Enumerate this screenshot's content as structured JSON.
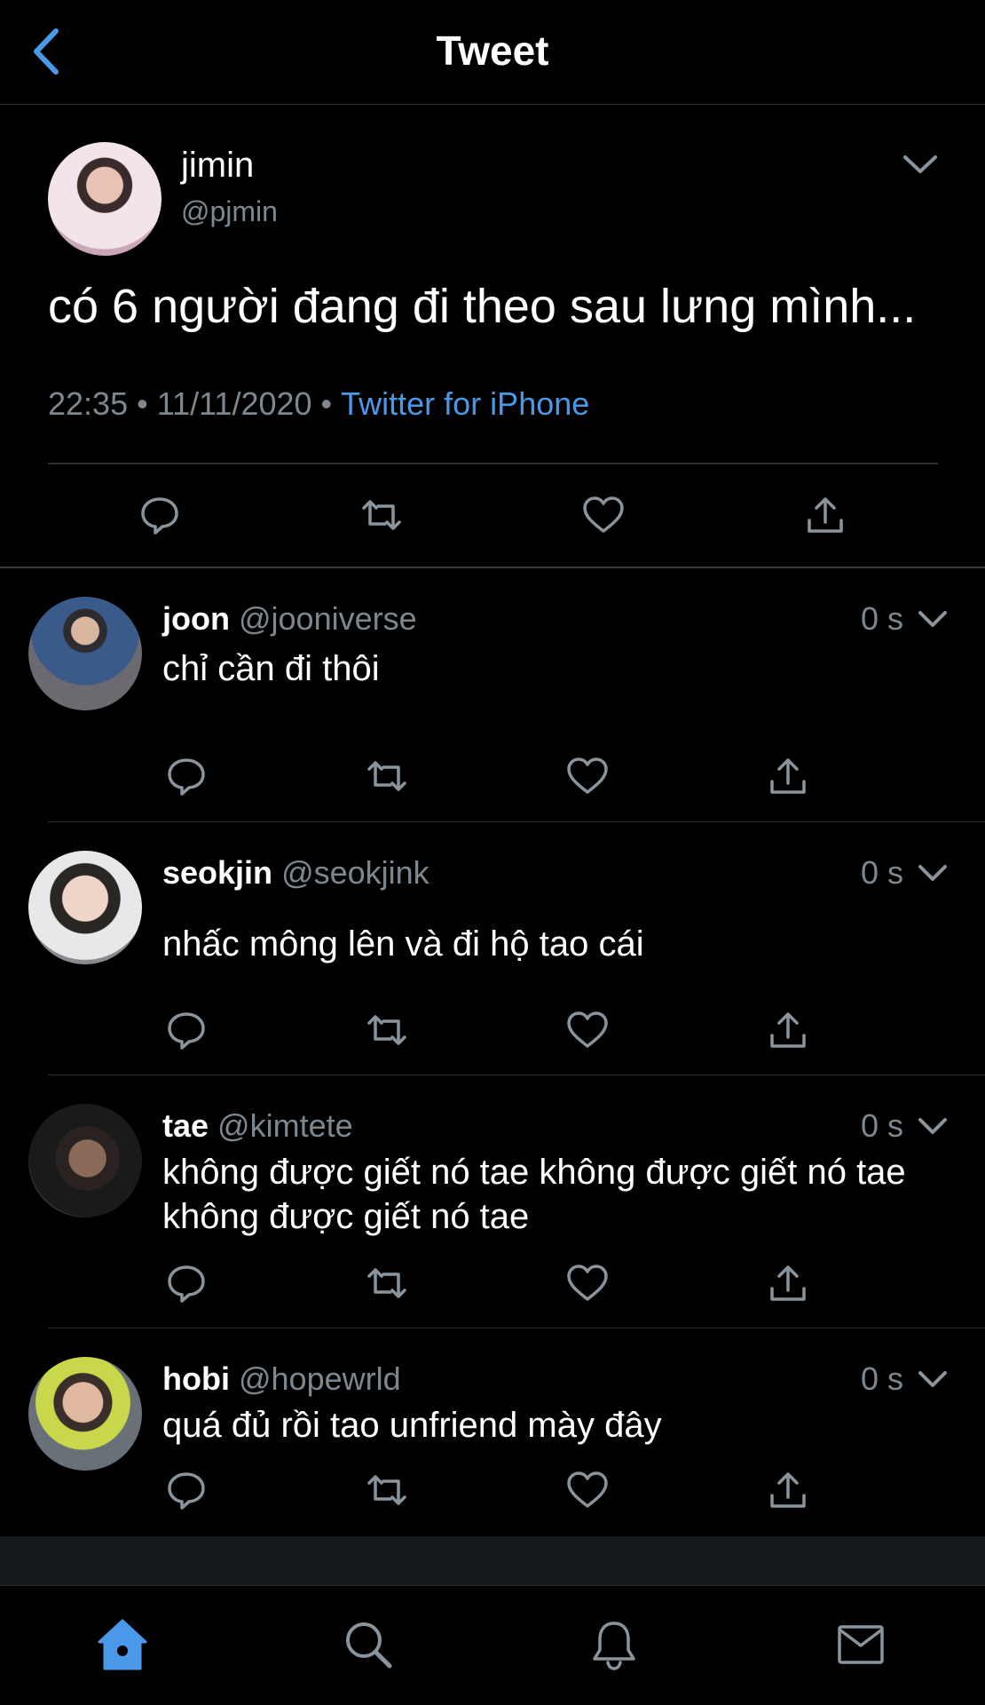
{
  "header": {
    "title": "Tweet",
    "back_icon": "chevron-left-icon"
  },
  "main_tweet": {
    "name": "jimin",
    "handle": "@pjmin",
    "text": "có 6 người đang đi theo sau lưng mình...",
    "time": "22:35",
    "date": "11/11/2020",
    "separator": "•",
    "source": "Twitter for iPhone",
    "actions": [
      "reply-icon",
      "retweet-icon",
      "like-icon",
      "share-icon"
    ]
  },
  "replies": [
    {
      "name": "joon",
      "handle": "@jooniverse",
      "time": "0 s",
      "text": "chỉ cần đi thôi"
    },
    {
      "name": "seokjin",
      "handle": "@seokjink",
      "time": "0 s",
      "text": "nhấc mông lên và đi hộ tao cái"
    },
    {
      "name": "tae",
      "handle": "@kimtete",
      "time": "0 s",
      "text": "không được giết nó tae không được giết nó tae không được giết nó tae"
    },
    {
      "name": "hobi",
      "handle": "@hopewrld",
      "time": "0 s",
      "text": "quá đủ rồi tao unfriend mày đây"
    }
  ],
  "tabbar": {
    "items": [
      "home-icon",
      "search-icon",
      "notifications-icon",
      "messages-icon"
    ],
    "active": "home-icon"
  },
  "colors": {
    "background": "#000000",
    "accent": "#4a99e9",
    "muted": "#7d8790",
    "icon": "#7d8790",
    "text": "#ffffff"
  }
}
